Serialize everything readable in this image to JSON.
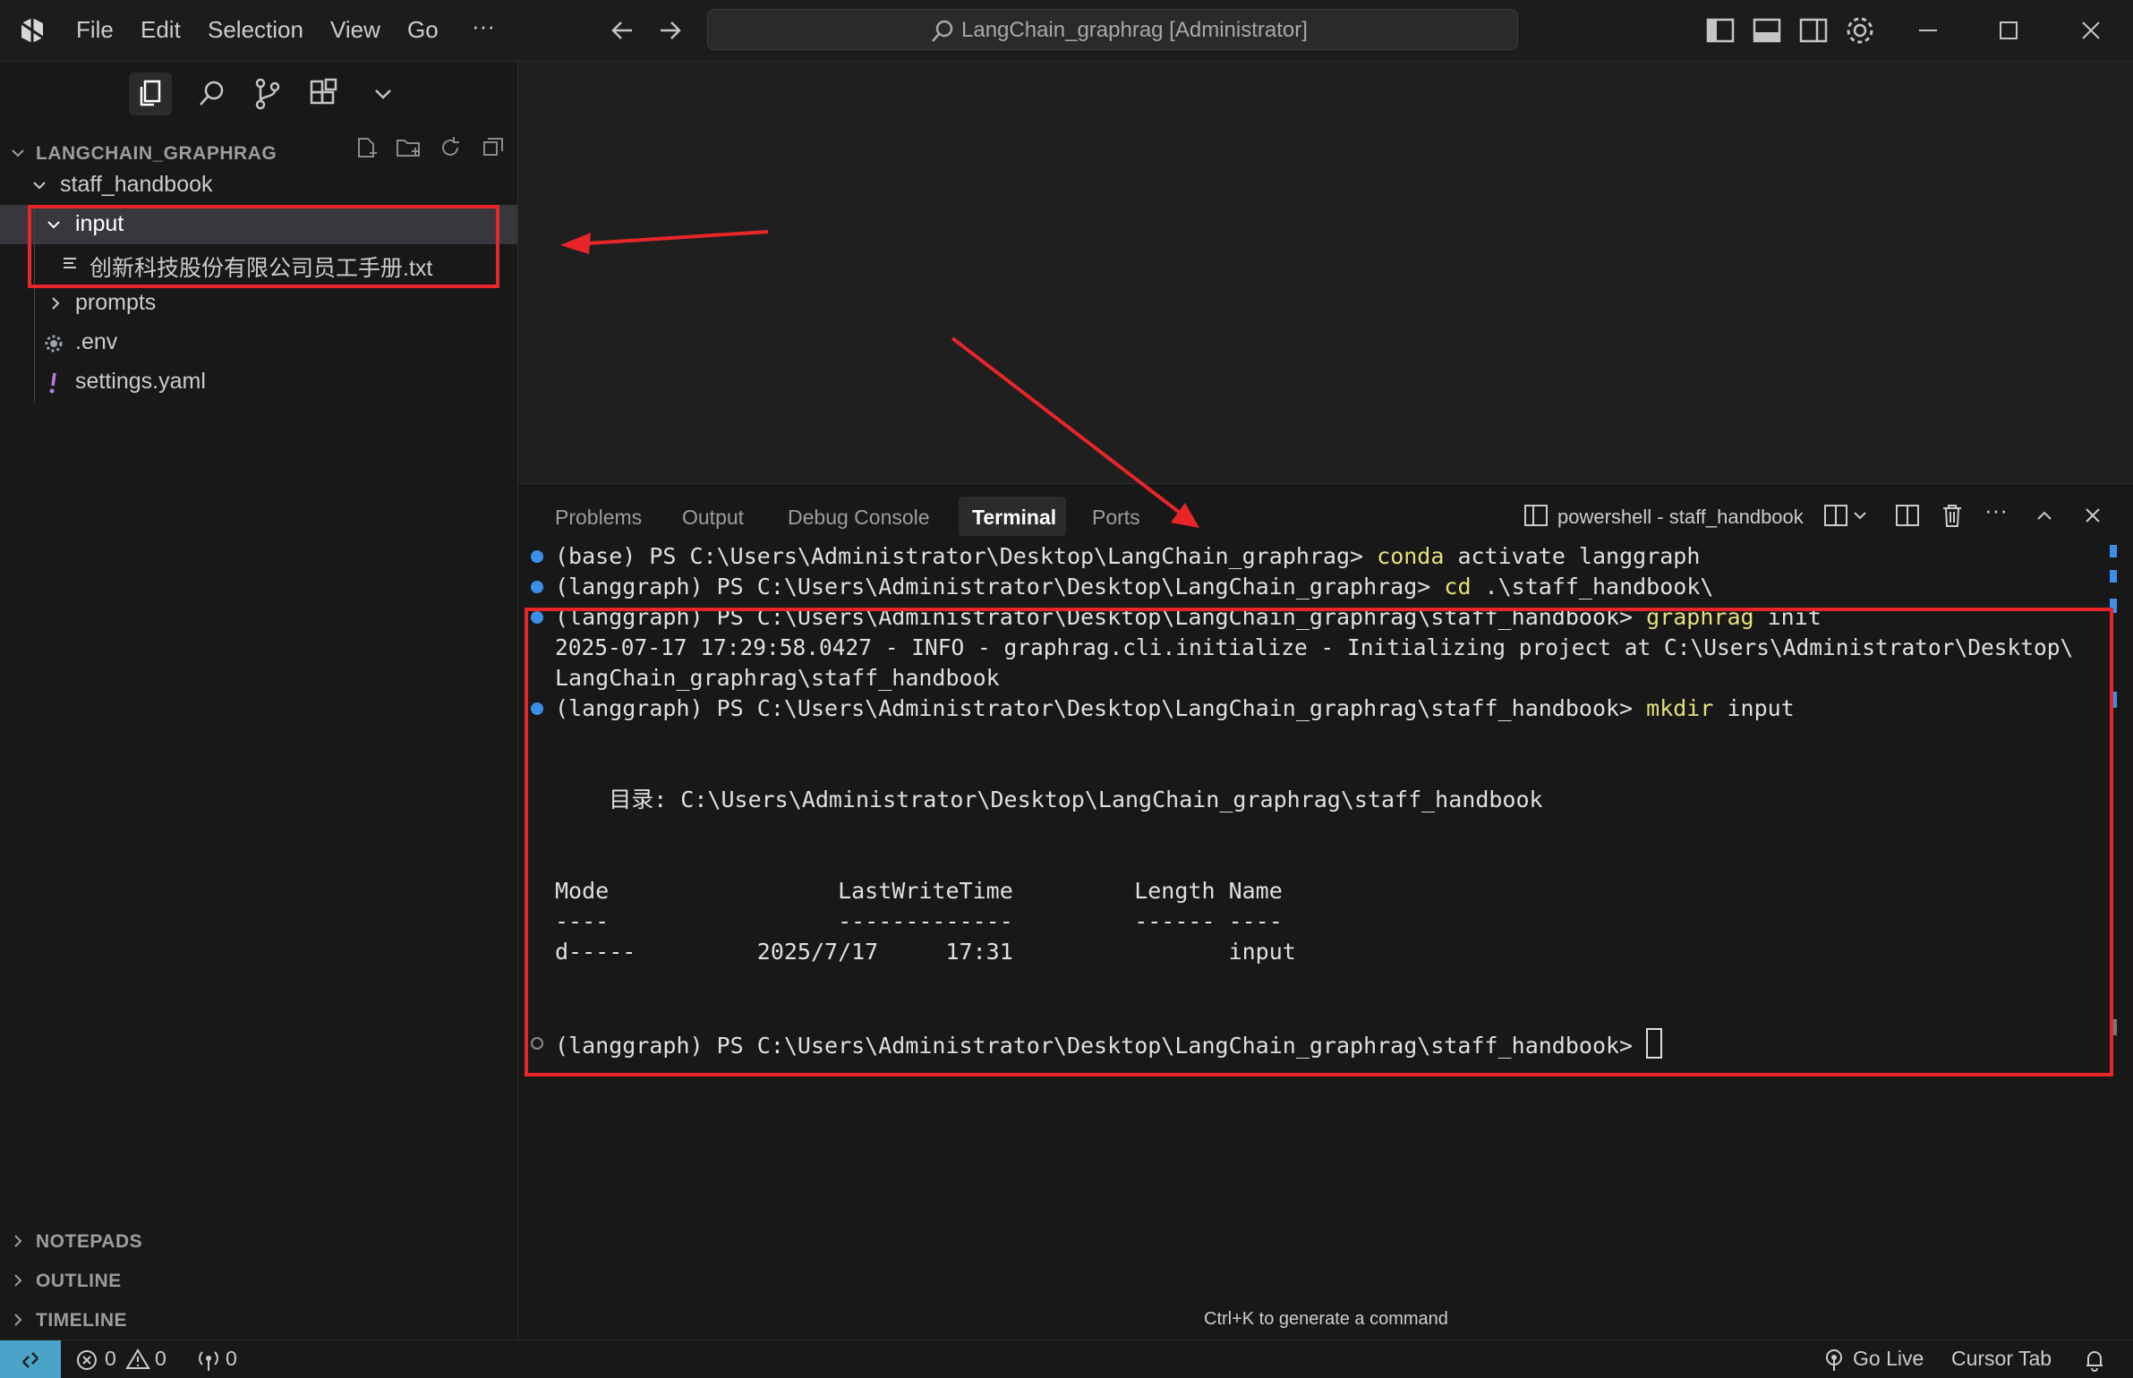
{
  "titlebar": {
    "menus": [
      "File",
      "Edit",
      "Selection",
      "View",
      "Go",
      "···"
    ],
    "search_label": "LangChain_graphrag [Administrator]"
  },
  "sidebar": {
    "root": "LANGCHAIN_GRAPHRAG",
    "tree": {
      "staff_handbook": "staff_handbook",
      "input": "input",
      "file": "创新科技股份有限公司员工手册.txt",
      "prompts": "prompts",
      "env": ".env",
      "settings": "settings.yaml"
    },
    "sections": [
      "NOTEPADS",
      "OUTLINE",
      "TIMELINE"
    ]
  },
  "panel": {
    "tabs": [
      "Problems",
      "Output",
      "Debug Console",
      "Terminal",
      "Ports"
    ],
    "active_tab": "Terminal",
    "terminal_name": "powershell - staff_handbook",
    "lines": {
      "l1_prompt": "(base) PS C:\\Users\\Administrator\\Desktop\\LangChain_graphrag> ",
      "l1_cmd": "conda",
      "l1_args": " activate langgraph",
      "l2_prompt": "(langgraph) PS C:\\Users\\Administrator\\Desktop\\LangChain_graphrag> ",
      "l2_cmd": "cd",
      "l2_args": " .\\staff_handbook\\",
      "l3_prompt": "(langgraph) PS C:\\Users\\Administrator\\Desktop\\LangChain_graphrag\\staff_handbook> ",
      "l3_cmd": "graphrag",
      "l3_args": " init",
      "l4": "2025-07-17 17:29:58.0427 - INFO - graphrag.cli.initialize - Initializing project at C:\\Users\\Administrator\\Desktop\\",
      "l5": "LangChain_graphrag\\staff_handbook",
      "l6_prompt": "(langgraph) PS C:\\Users\\Administrator\\Desktop\\LangChain_graphrag\\staff_handbook> ",
      "l6_cmd": "mkdir",
      "l6_args": " input",
      "dir": "    目录: C:\\Users\\Administrator\\Desktop\\LangChain_graphrag\\staff_handbook",
      "header": "Mode                 LastWriteTime         Length Name",
      "sep": "----                 -------------         ------ ----",
      "row": "d-----         2025/7/17     17:31                input",
      "last_prompt": "(langgraph) PS C:\\Users\\Administrator\\Desktop\\LangChain_graphrag\\staff_handbook> "
    },
    "hint": "Ctrl+K to generate a command"
  },
  "statusbar": {
    "errors": "0",
    "warnings": "0",
    "ports": "0",
    "go_live": "Go Live",
    "cursor_tab": "Cursor Tab"
  },
  "colors": {
    "accent": "#4aa3c8",
    "annotation": "#e8262a",
    "command": "#e5e07a"
  }
}
